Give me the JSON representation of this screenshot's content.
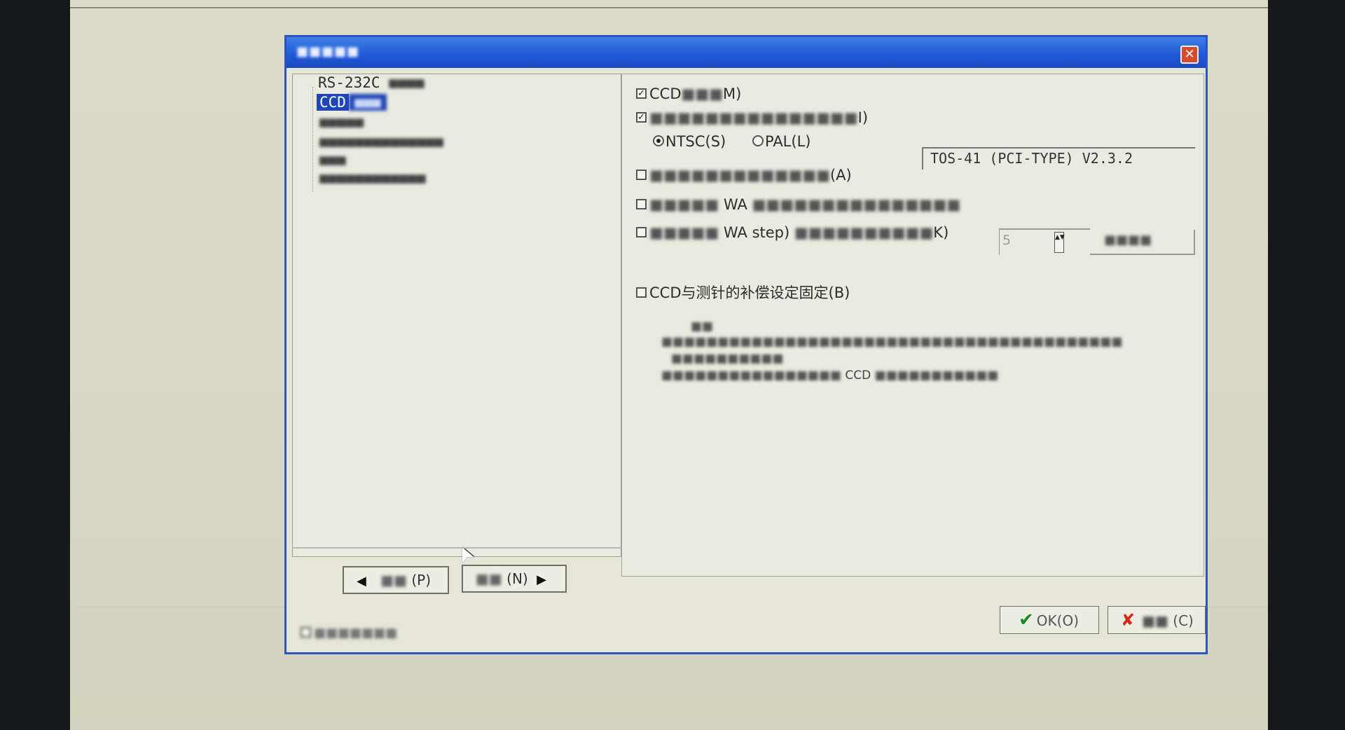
{
  "dialog": {
    "title": "■■■■■",
    "close_glyph": "✕"
  },
  "tree": {
    "items": [
      {
        "label": "RS-232C",
        "suffix": "■■■■"
      },
      {
        "label": "CCD",
        "suffix": "■■■"
      },
      {
        "label": "",
        "suffix": "■■■■■"
      },
      {
        "label": "",
        "suffix": "■■■■■■■■■■■■■■"
      },
      {
        "label": "",
        "suffix": "■■■"
      },
      {
        "label": "",
        "suffix": "■■■■■■■■■■■■"
      }
    ]
  },
  "nav": {
    "prev_arrow": "◀",
    "prev_label": "■■",
    "prev_shortcut": "(P)",
    "next_label": "■■",
    "next_shortcut": "(N)",
    "next_arrow": "▶"
  },
  "settings": {
    "ccd_checkbox": {
      "prefix": "CCD",
      "blur": "■■■",
      "shortcut": "M)",
      "checked": true
    },
    "card_checkbox": {
      "blur": "■■■■■■■■■■■■■■■",
      "shortcut": "I)",
      "checked": true
    },
    "card_version": "TOS-41 (PCI-TYPE) V2.3.2",
    "ntsc_label": "NTSC(S)",
    "pal_label": "PAL(L)",
    "option_a": {
      "blur": "■■■■■■■■■■■■■",
      "shortcut": "(A)"
    },
    "option_wa": {
      "blur1": "■■■■■",
      "text": "WA",
      "blur2": "■■■■■■■■■■■■■■■"
    },
    "spin_value": "5",
    "spin_arrows": "▲▼",
    "unit_blur": "■■■■",
    "option_step": {
      "blur1": "■■■■■",
      "text": "WA step)",
      "blur2": "■■■■■■■■■■",
      "shortcut": "K)"
    },
    "fix_checkbox": "CCD与测针的补偿设定固定(B)",
    "desc_lines": [
      "■■",
      "■■■■■■■■■■■■■■■■■■■■■■■■■■■■■■■■■■■■■■■■■",
      "■■■■■■■■■■",
      "■■■■■■■■■■■■■■■■"
    ],
    "desc_ccd": "CCD",
    "desc_tail": "■■■■■■■■■■■"
  },
  "buttons": {
    "ok_icon": "✔",
    "ok_label": "OK(O)",
    "cancel_icon": "✘",
    "cancel_blur": "■■",
    "cancel_shortcut": "(C)"
  },
  "footer": {
    "checkbox_blur": "■■■■■■■"
  },
  "cursor": "➤"
}
